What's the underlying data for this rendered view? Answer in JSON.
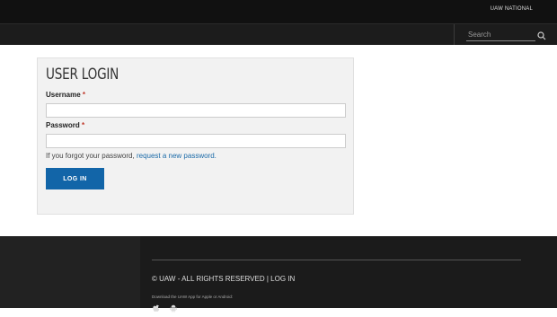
{
  "topbar": {
    "national_link": "UAW NATIONAL"
  },
  "navbar": {
    "search_placeholder": "Search"
  },
  "login": {
    "title": "USER LOGIN",
    "username_label": "Username",
    "password_label": "Password",
    "required_mark": "*",
    "forgot_text": "If you forgot your password,",
    "forgot_link": "request a new password.",
    "login_button": "LOG IN"
  },
  "footer": {
    "copyright": "© UAW - ALL RIGHTS RESERVED",
    "separator": "|",
    "login_link": "LOG IN",
    "download_text": "Download the UAW App for Apple or Android:",
    "apps": [
      "apple-icon",
      "android-icon"
    ]
  },
  "colors": {
    "accent": "#1265a8",
    "required": "#c0392b",
    "header_bg": "#111111",
    "footer_bg": "#1b1b1b"
  }
}
